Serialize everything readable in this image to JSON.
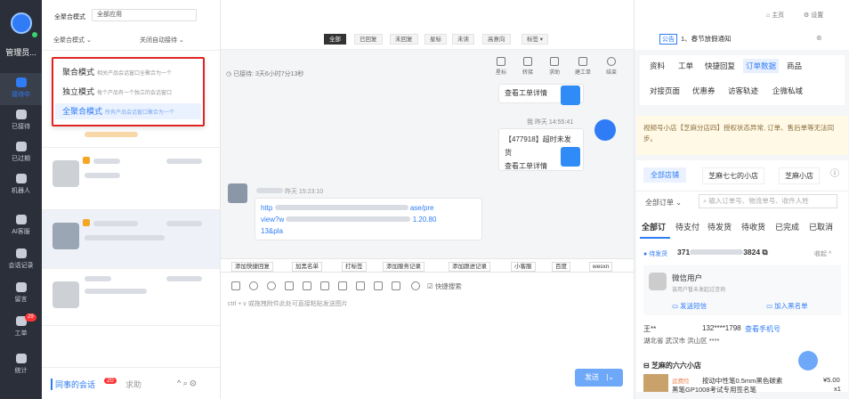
{
  "nav": {
    "user": "管理员...",
    "items": [
      {
        "label": "接待中",
        "active": true
      },
      {
        "label": "已接待"
      },
      {
        "label": "已过期"
      },
      {
        "label": "机器人"
      },
      {
        "label": "AI客服"
      },
      {
        "label": "会话记录"
      },
      {
        "label": "留言"
      },
      {
        "label": "工单",
        "badge": "29"
      },
      {
        "label": "统计"
      }
    ]
  },
  "list": {
    "mode_label": "全聚合模式",
    "mode_value": "全部应用",
    "mode_select": "全聚合模式",
    "auto_label": "关闭自动接待",
    "dropdown": [
      {
        "label": "聚合模式",
        "desc": "相关产品会话窗口全聚合为一个"
      },
      {
        "label": "独立模式",
        "desc": "每个产品有一个独立的会话窗口"
      },
      {
        "label": "全聚合模式",
        "desc": "所有产品会话窗口聚合为一个"
      }
    ],
    "bottom_tab1": "同事的会话",
    "bottom_badge": "20",
    "bottom_tab2": "求助"
  },
  "chat": {
    "filters": [
      "全部",
      "已回复",
      "未回复",
      "星标",
      "未读",
      "高意向",
      "标签 ▾"
    ],
    "status": "已接待: 3天6小时7分13秒",
    "tools": [
      "星标",
      "转接",
      "求助",
      "建工单",
      "结束"
    ],
    "ticket_link": "查看工单详情",
    "robot_time": "我 昨天 14:55:41",
    "ticket_msg": "【477918】超时未发货",
    "ticket_link2": "查看工单详情",
    "user_time": "昨天 15:23:10",
    "url1": "http",
    "url2": "ase/pre",
    "url3": "view?w",
    "url4": "1.20.80",
    "url5": "13&pla",
    "actions": [
      "添加快捷回复",
      "加黑名单",
      "打标签",
      "添加服务记录",
      "添加跟进记录",
      "小客服",
      "百度",
      "wesxn"
    ],
    "quick_search": "快捷搜索",
    "placeholder": "ctrl + v 或拖拽附件此处可直接粘贴发送图片",
    "send": "发送"
  },
  "right": {
    "top_tag": "公告",
    "notice": "1、春节放假通知",
    "home": "主页",
    "settings": "设置",
    "tabs1": [
      "资料",
      "工单",
      "快捷回复",
      "订单数据",
      "商品"
    ],
    "tabs2": [
      "对接页面",
      "优惠券",
      "访客轨迹",
      "企微私域"
    ],
    "warning": "视频号小店【芝麻分店四】授权状态异常, 订单、售后单等无法同步。",
    "shops": [
      "全部店铺",
      "芝麻七七的小店",
      "芝麻小店"
    ],
    "order_filter": "全部订单",
    "order_search": "输入订单号、物流单号、收件人姓",
    "order_tabs": [
      "全部订",
      "待支付",
      "待发货",
      "待收货",
      "已完成",
      "已取消"
    ],
    "order_status": "待发货",
    "order_no_a": "371",
    "order_no_b": "3824",
    "collapse": "收起 ^",
    "wx_user": "微信用户",
    "wx_sub": "该用户暂未发起过咨询",
    "sms": "发送短信",
    "blacklist": "加入黑名单",
    "name": "王**",
    "phone": "132****1798",
    "phone_link": "查看手机号",
    "address": "湖北省 武汉市 洪山区 ****",
    "shop": "芝麻的六六小店",
    "product_tag": "运费险",
    "product": "按动中性笔0.5mm黑色碳素",
    "price": "¥5.00",
    "product2": "黑笔GP1008考试专用签名笔",
    "qty": "x1"
  }
}
